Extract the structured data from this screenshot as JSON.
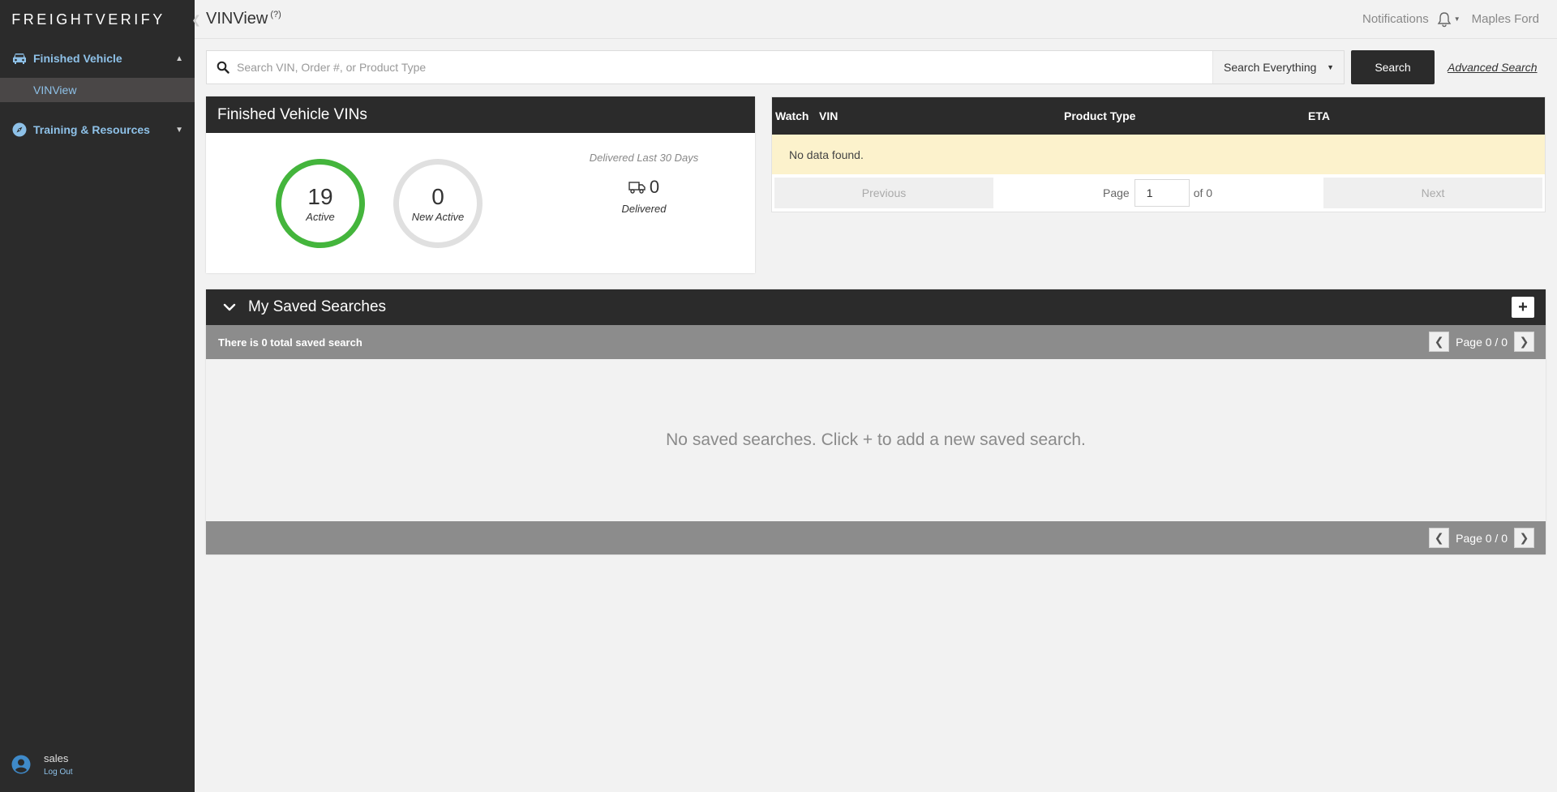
{
  "brand": {
    "logo_text": "FREIGHTVERIFY"
  },
  "sidebar": {
    "sections": [
      {
        "label": "Finished Vehicle",
        "icon": "car-icon",
        "expanded": true,
        "items": [
          {
            "label": "VINView",
            "active": true
          }
        ]
      },
      {
        "label": "Training & Resources",
        "icon": "compass-icon",
        "expanded": false
      }
    ],
    "user": {
      "name": "sales",
      "logout_label": "Log Out"
    }
  },
  "topbar": {
    "title": "VINView",
    "help_glyph": "?",
    "notifications_label": "Notifications",
    "account_name": "Maples Ford"
  },
  "search": {
    "placeholder": "Search VIN, Order #, or Product Type",
    "value": "",
    "scope": "Search Everything",
    "button_label": "Search",
    "advanced_label": "Advanced Search"
  },
  "vin_card": {
    "title": "Finished Vehicle VINs",
    "active_count": "19",
    "active_label": "Active",
    "new_active_count": "0",
    "new_active_label": "New Active",
    "delivered_title": "Delivered Last 30 Days",
    "delivered_count": "0",
    "delivered_label": "Delivered",
    "colors": {
      "active_ring": "#44b53c",
      "new_ring": "#e0e0e0"
    }
  },
  "vin_table": {
    "columns": [
      "Watch",
      "VIN",
      "Product Type",
      "ETA"
    ],
    "empty_message": "No data found.",
    "pagination": {
      "previous_label": "Previous",
      "page_label": "Page",
      "page_value": "1",
      "of_label": "of 0",
      "next_label": "Next"
    }
  },
  "saved_searches": {
    "title": "My Saved Searches",
    "add_glyph": "+",
    "count_text": "There is 0 total saved search",
    "page_text": "Page 0 / 0",
    "empty_message": "No saved searches. Click + to add a new saved search."
  }
}
